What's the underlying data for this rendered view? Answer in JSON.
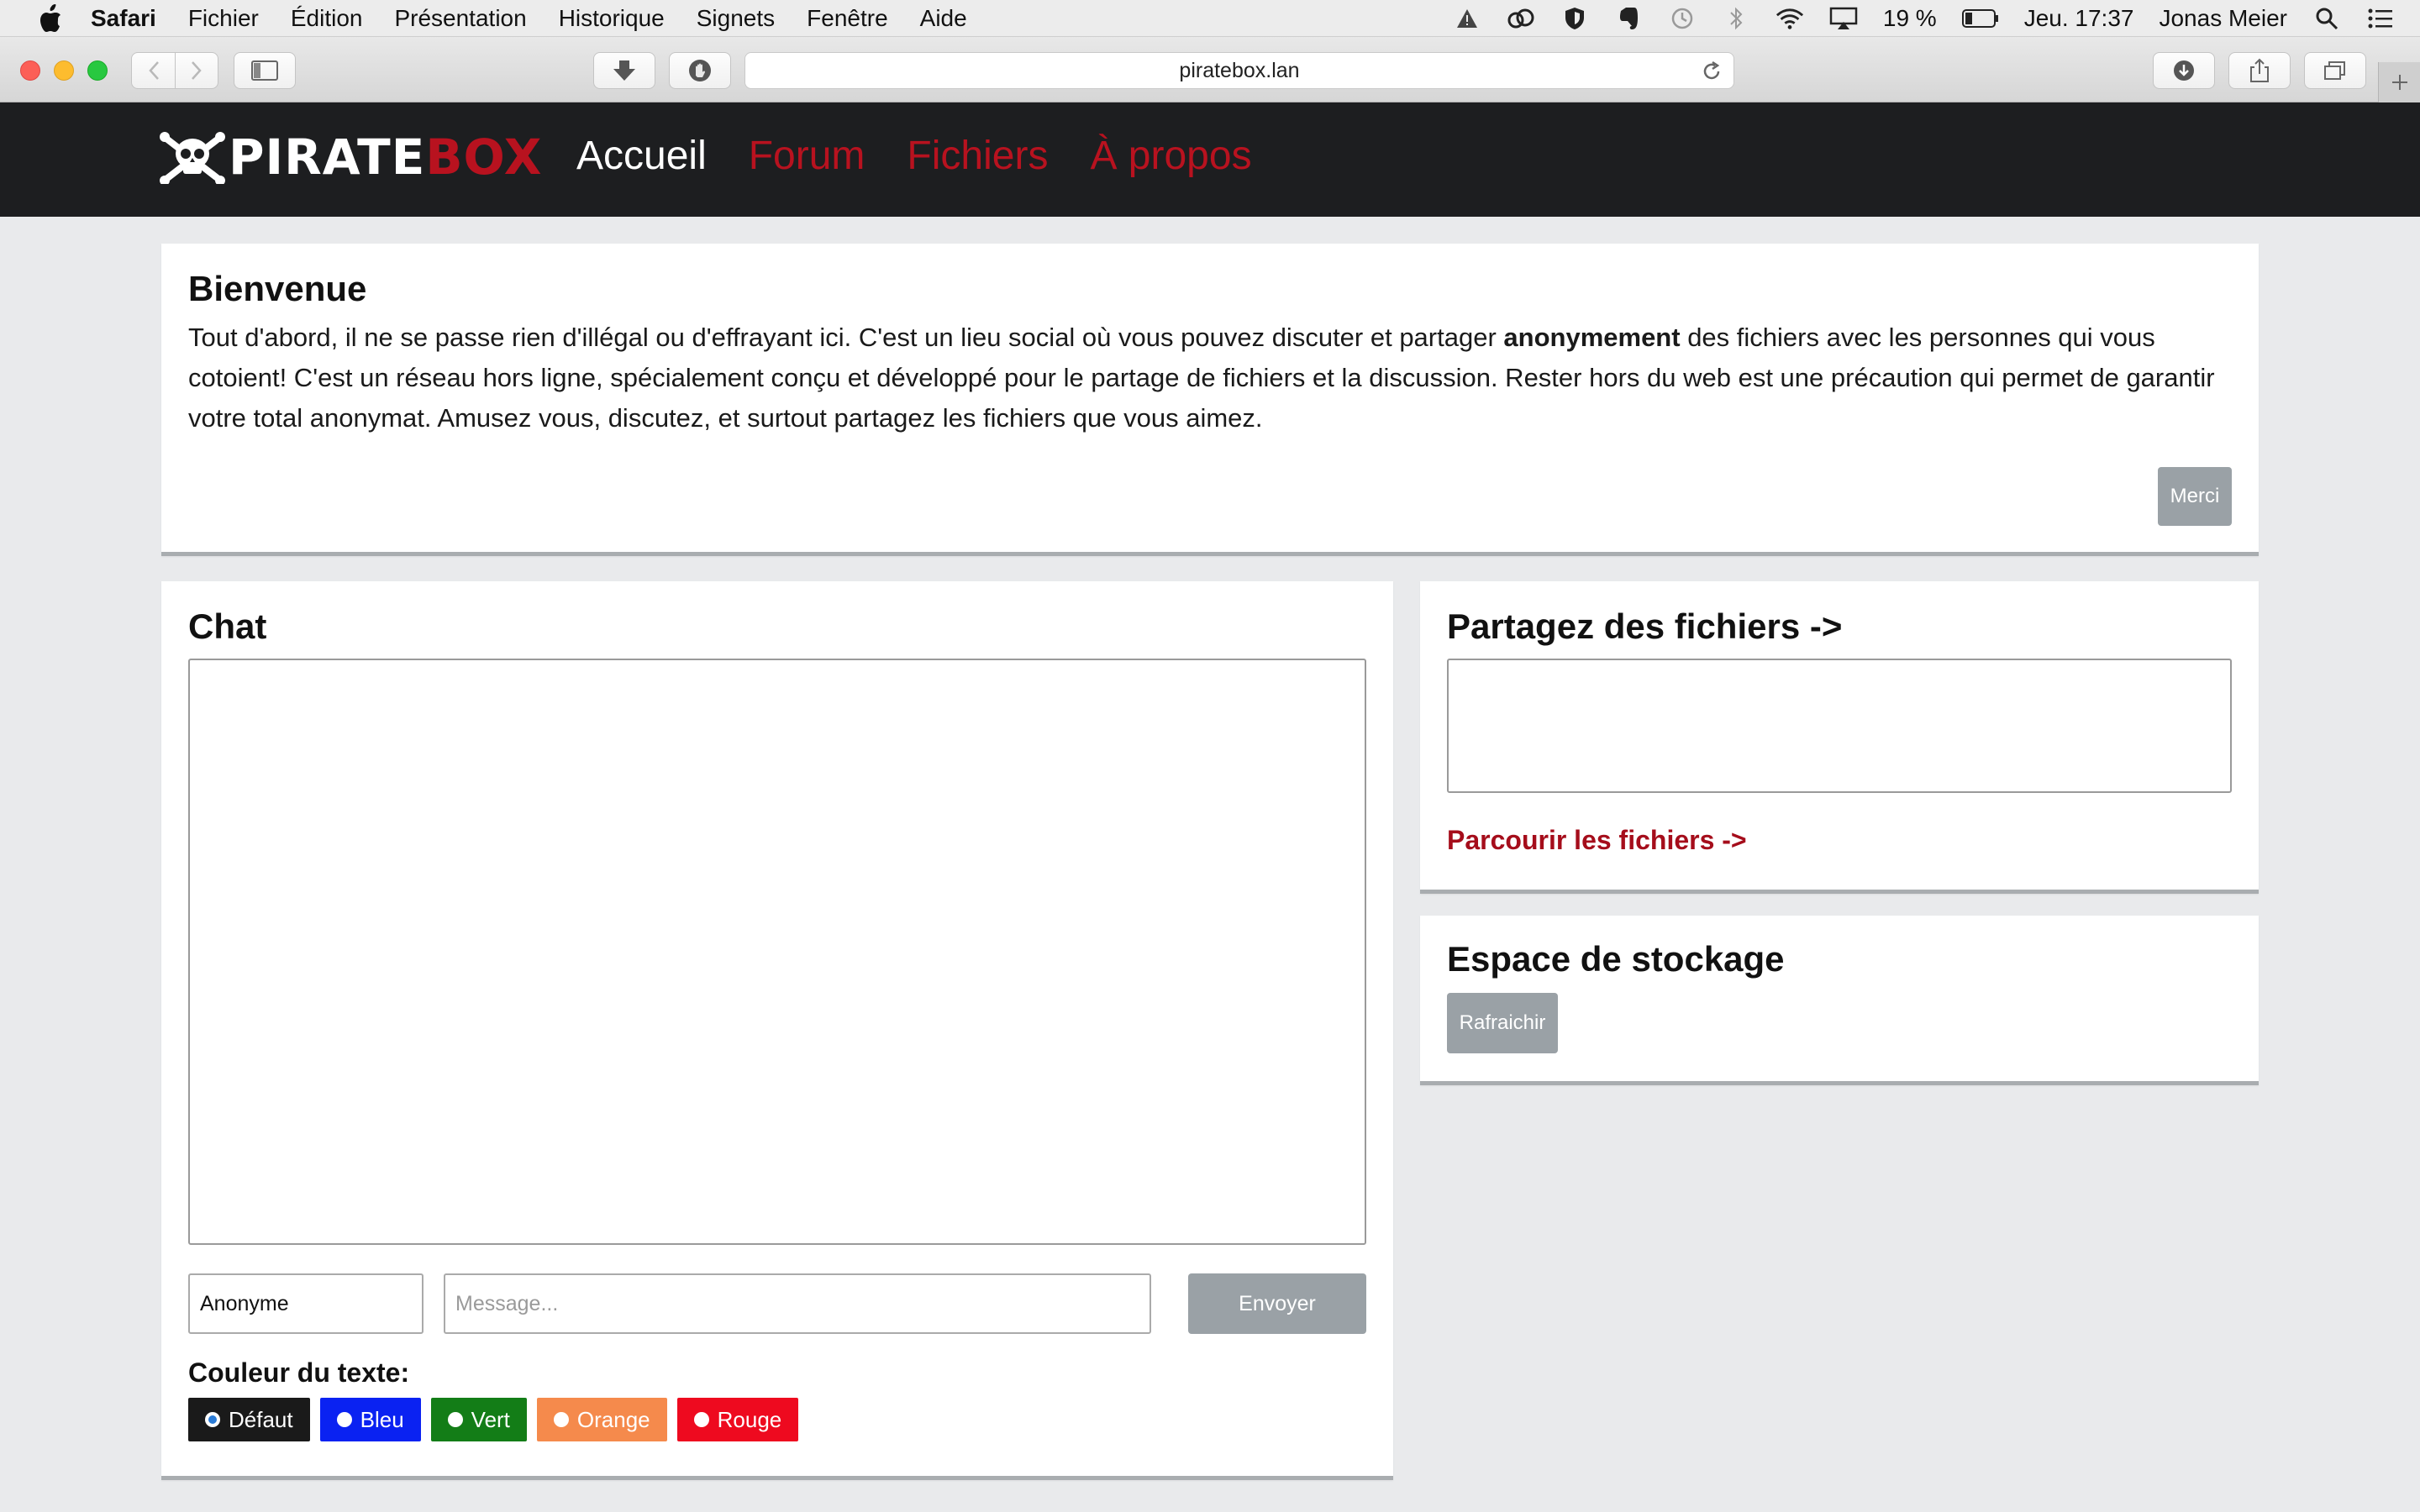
{
  "menubar": {
    "app": "Safari",
    "items": [
      "Fichier",
      "Édition",
      "Présentation",
      "Historique",
      "Signets",
      "Fenêtre",
      "Aide"
    ],
    "battery": "19 %",
    "clock": "Jeu. 17:37",
    "user": "Jonas Meier"
  },
  "browser": {
    "url": "piratebox.lan"
  },
  "site": {
    "logo_white": "PIRATE",
    "logo_red": "BOX",
    "nav": [
      "Accueil",
      "Forum",
      "Fichiers",
      "À propos"
    ],
    "colors": {
      "nav_bg": "#1d1e20",
      "accent_red": "#b8121f",
      "link_red": "#a50d1b",
      "page_bg": "#e9eaec"
    }
  },
  "welcome": {
    "title": "Bienvenue",
    "text_before": "Tout d'abord, il ne se passe rien d'illégal ou d'effrayant ici. C'est un lieu social où vous pouvez discuter et partager ",
    "text_bold": "anonymement",
    "text_after": " des fichiers avec les personnes qui vous cotoient! C'est un réseau hors ligne, spécialement conçu et développé pour le partage de fichiers et la discussion. Rester hors du web est une précaution qui permet de garantir votre total anonymat. Amusez vous, discutez, et surtout partagez les fichiers que vous aimez.",
    "button": "Merci"
  },
  "chat": {
    "title": "Chat",
    "nickname_value": "Anonyme",
    "message_placeholder": "Message...",
    "send": "Envoyer",
    "color_label": "Couleur du texte:",
    "color_options": [
      {
        "label": "Défaut",
        "color": "#1a1a1a",
        "selected": true
      },
      {
        "label": "Bleu",
        "color": "#0a22f2",
        "selected": false
      },
      {
        "label": "Vert",
        "color": "#137d17",
        "selected": false
      },
      {
        "label": "Orange",
        "color": "#f58a4c",
        "selected": false
      },
      {
        "label": "Rouge",
        "color": "#ee0a1f",
        "selected": false
      }
    ]
  },
  "share": {
    "title": "Partagez des fichiers ->",
    "browse_link": "Parcourir les fichiers ->"
  },
  "storage": {
    "title": "Espace de stockage",
    "button": "Rafraichir"
  }
}
